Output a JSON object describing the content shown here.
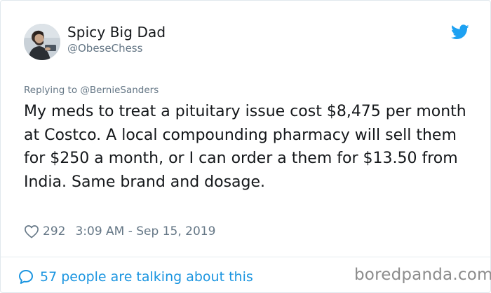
{
  "author": {
    "name": "Spicy Big Dad",
    "handle": "@ObeseChess"
  },
  "reply": {
    "prefix": "Replying to ",
    "mention": "@BernieSanders"
  },
  "tweet": {
    "text": "My meds to treat a pituitary issue cost $8,475 per month at Costco. A local compounding pharmacy will sell them for $250 a month, or I can order a them for $13.50 from India. Same brand and dosage."
  },
  "meta": {
    "likes": "292",
    "timestamp": "3:09 AM - Sep 15, 2019"
  },
  "footer": {
    "talking": "57 people are talking about this"
  },
  "watermark": "boredpanda.com",
  "icons": {
    "bird": "twitter-bird-icon",
    "heart": "heart-outline-icon",
    "bubble": "speech-bubble-icon"
  },
  "colors": {
    "twitter_blue": "#1da1f2",
    "link_blue": "#1b95e0",
    "muted": "#657786",
    "text": "#14171a"
  }
}
